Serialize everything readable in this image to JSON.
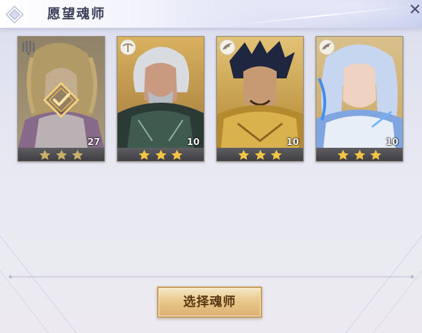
{
  "header": {
    "title": "愿望魂师",
    "close_symbol": "✕"
  },
  "cards": [
    {
      "name": "card-1",
      "level": "27",
      "stars": 3,
      "badge_icon": "lock-bars-icon",
      "selected": true
    },
    {
      "name": "card-2",
      "level": "10",
      "stars": 3,
      "badge_icon": "staff-icon",
      "selected": false
    },
    {
      "name": "card-3",
      "level": "10",
      "stars": 3,
      "badge_icon": "wing-icon",
      "selected": false
    },
    {
      "name": "card-4",
      "level": "10",
      "stars": 3,
      "badge_icon": "wing-icon",
      "selected": false
    }
  ],
  "footer": {
    "select_button_label": "选择魂师"
  },
  "colors": {
    "accent_gold": "#e5c079",
    "star_gold": "#f4c542",
    "title_text": "#3b3f59"
  }
}
